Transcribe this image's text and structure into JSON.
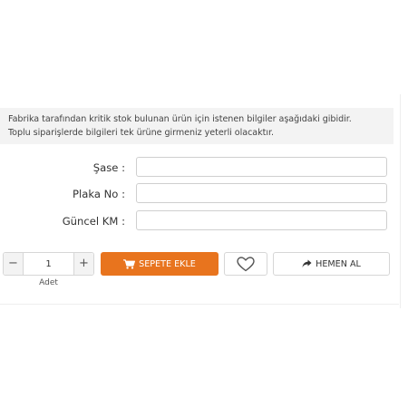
{
  "info": {
    "line1": "Fabrika tarafından kritik stok bulunan ürün için istenen bilgiler aşağıdaki gibidir.",
    "line2": "Toplu siparişlerde bilgileri tek ürüne girmeniz yeterli olacaktır."
  },
  "form": {
    "fields": [
      {
        "label": "Şase :",
        "value": ""
      },
      {
        "label": "Plaka No :",
        "value": ""
      },
      {
        "label": "Güncel KM :",
        "value": ""
      }
    ]
  },
  "quantity": {
    "minus": "−",
    "plus": "+",
    "value": "1",
    "caption": "Adet"
  },
  "actions": {
    "cart_label": "SEPETE EKLE",
    "cart_icon": "shopping-cart-icon",
    "favorite_icon": "heart-icon",
    "buy_now_label": "HEMEN AL",
    "buy_now_icon": "share-arrow-icon"
  },
  "colors": {
    "accent": "#e8741e",
    "info_background": "#f3f3f3",
    "border": "#d6d6d6"
  }
}
